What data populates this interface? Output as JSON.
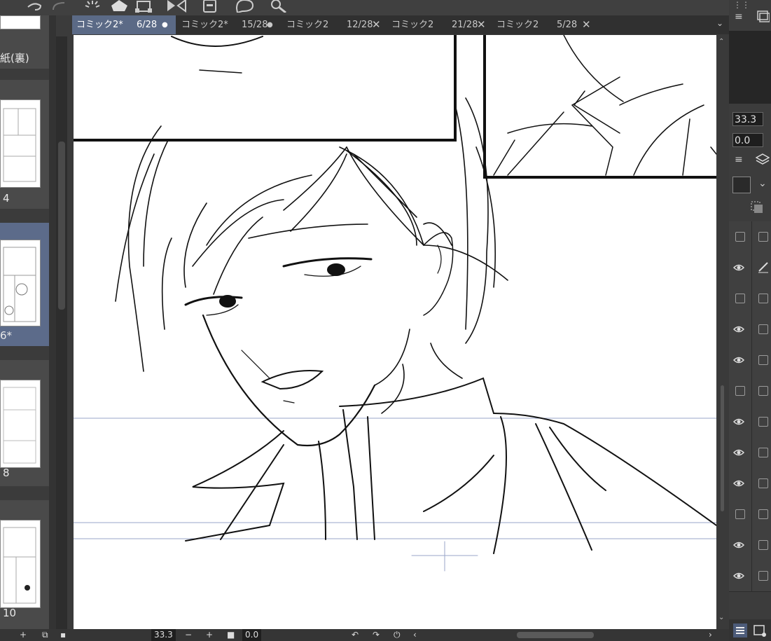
{
  "toolbar": {
    "icons": [
      "undo-icon",
      "redo-icon",
      "spin-icon",
      "fill-icon",
      "transform-icon",
      "flip-icon",
      "device-icon",
      "help-icon",
      "settings-icon"
    ]
  },
  "tabs": [
    {
      "name": "コミック2*",
      "page": "6/28",
      "marker": "●",
      "active": true
    },
    {
      "name": "コミック2*",
      "page": "15/28",
      "marker": "●",
      "active": false
    },
    {
      "name": "コミック2",
      "page": "12/28",
      "marker": "✕",
      "active": false
    },
    {
      "name": "コミック2",
      "page": "21/28",
      "marker": "✕",
      "active": false
    },
    {
      "name": "コミック2",
      "page": "5/28",
      "marker": "✕",
      "active": false
    }
  ],
  "pages": {
    "top_label": "紙(裏)",
    "items": [
      {
        "label": "4",
        "selected": false
      },
      {
        "label": "6*",
        "selected": true
      },
      {
        "label": "8",
        "selected": false
      },
      {
        "label": "10",
        "selected": false
      }
    ]
  },
  "bottom": {
    "add_label": "+",
    "zoom_value": "33.3",
    "minus_label": "−",
    "plus_label": "+",
    "angle_value": "0.0"
  },
  "right_panel": {
    "zoom_value": "33.3",
    "angle_value": "0.0",
    "layers": [
      {
        "visible": false
      },
      {
        "visible": true,
        "pen": true
      },
      {
        "visible": false
      },
      {
        "visible": true
      },
      {
        "visible": true
      },
      {
        "visible": false
      },
      {
        "visible": true
      },
      {
        "visible": true
      },
      {
        "visible": true
      },
      {
        "visible": false
      },
      {
        "visible": true
      },
      {
        "visible": true
      }
    ]
  },
  "colors": {
    "active_tab": "#5b6a86",
    "selected_page": "#5c6b8a",
    "panel_bg": "#3b3b3b"
  }
}
